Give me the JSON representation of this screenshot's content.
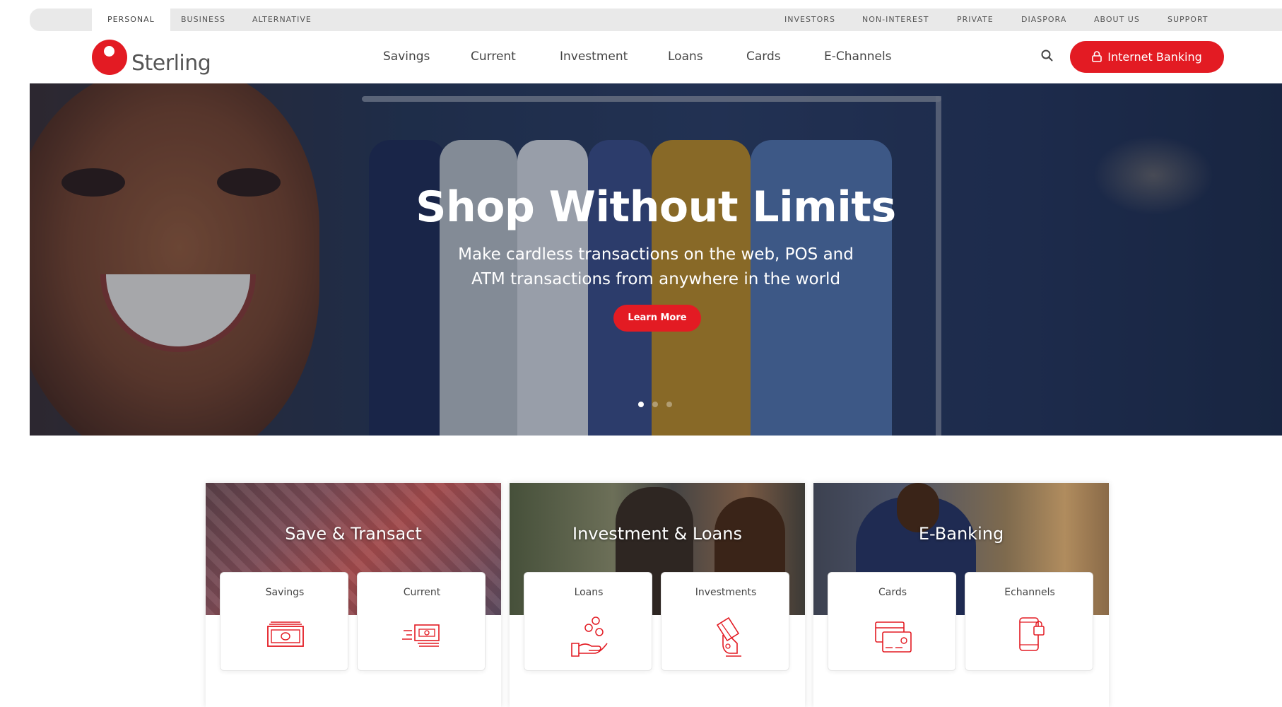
{
  "topbar": {
    "left": [
      "PERSONAL",
      "BUSINESS",
      "ALTERNATIVE"
    ],
    "right": [
      "INVESTORS",
      "NON-INTEREST",
      "PRIVATE",
      "DIASPORA",
      "ABOUT US",
      "SUPPORT"
    ]
  },
  "brand": {
    "name": "Sterling",
    "accent": "#e31b23"
  },
  "nav": {
    "items": [
      "Savings",
      "Current",
      "Investment",
      "Loans",
      "Cards",
      "E-Channels"
    ],
    "internet_banking": "Internet Banking"
  },
  "hero": {
    "title": "Shop Without Limits",
    "subtitle_line1": "Make cardless transactions on the web, POS and",
    "subtitle_line2": "ATM transactions from anywhere in the world",
    "cta": "Learn More",
    "slide_count": 3,
    "active_slide": 1
  },
  "cards": [
    {
      "title": "Save & Transact",
      "items": [
        {
          "label": "Savings",
          "icon": "cash-icon"
        },
        {
          "label": "Current",
          "icon": "money-transfer-icon"
        }
      ]
    },
    {
      "title": "Investment & Loans",
      "items": [
        {
          "label": "Loans",
          "icon": "hand-coins-icon"
        },
        {
          "label": "Investments",
          "icon": "hand-card-icon"
        }
      ]
    },
    {
      "title": "E-Banking",
      "items": [
        {
          "label": "Cards",
          "icon": "credit-cards-icon"
        },
        {
          "label": "Echannels",
          "icon": "mobile-lock-icon"
        }
      ]
    }
  ]
}
